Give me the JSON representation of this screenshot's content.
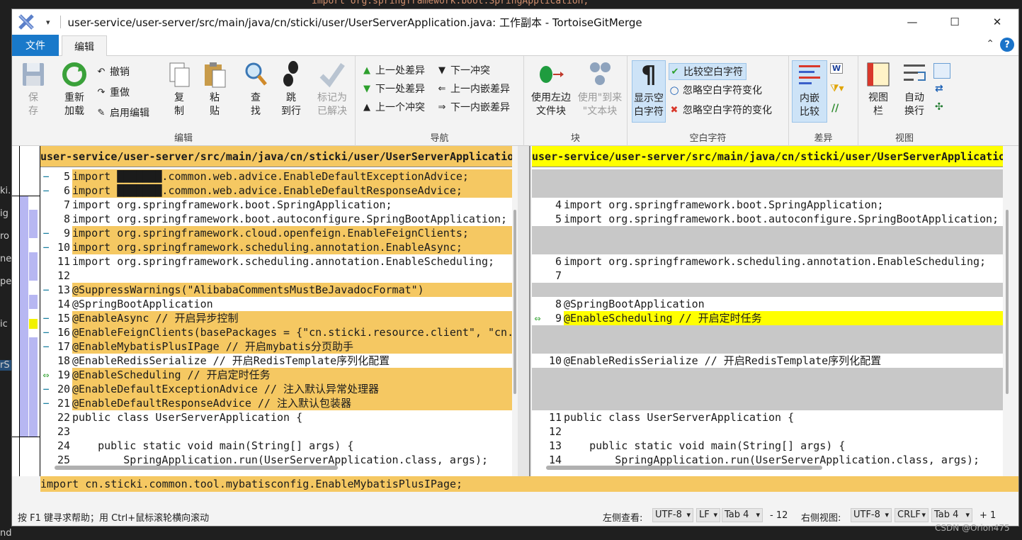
{
  "window": {
    "title": "user-service/user-server/src/main/java/cn/sticki/user/UserServerApplication.java: 工作副本 - TortoiseGitMerge",
    "minimize": "—",
    "maximize": "☐",
    "close": "✕"
  },
  "background": {
    "top_code": "import org.springframework.boot.SpringApplication;",
    "left_snippets": [
      "ki.u",
      "ig",
      "ro",
      "ne",
      "pe",
      "ic",
      "rS",
      "nd"
    ],
    "watermark": "CSDN @Orion475"
  },
  "tabs": {
    "file": "文件",
    "edit": "编辑"
  },
  "ribbon": {
    "edit_group": {
      "name": "编辑",
      "save": "保\n存",
      "reload": "重新\n加载",
      "undo": "撤销",
      "redo": "重做",
      "enable_edit": "启用编辑",
      "copy": "复\n制",
      "paste": "粘\n贴"
    },
    "nav_group": {
      "name": "导航",
      "find": "查\n找",
      "goto": "跳\n到行",
      "mark_resolved": "标记为\n已解决",
      "prev_diff": "上一处差异",
      "next_diff": "下一处差异",
      "prev_conflict": "上一个冲突",
      "next_conflict": "下一冲突",
      "prev_inline": "上一内嵌差异",
      "next_inline": "下一内嵌差异"
    },
    "block_group": {
      "name": "块",
      "use_left": "使用左边\n文件块",
      "use_from": "使用\"到来\n\"文本块"
    },
    "whitespace_group": {
      "name": "空白字符",
      "show_ws": "显示空\n白字符",
      "compare_ws": "比较空白字符",
      "ignore_ws_change": "忽略空白字符变化",
      "ignore_ws_all": "忽略空白字符的变化"
    },
    "diff_group": {
      "name": "差异",
      "inline": "内嵌\n比较"
    },
    "view_group": {
      "name": "视图",
      "viewbar": "视图\n栏",
      "wrap": "自动\n换行"
    }
  },
  "left_pane": {
    "path": "user-service/user-server/src/main/java/cn/sticki/user/UserServerApplication.java",
    "lines": [
      {
        "n": "5",
        "m": "−",
        "t": "import ███████.common.web.advice.EnableDefaultExceptionAdvice;",
        "bg": "#f5c862"
      },
      {
        "n": "6",
        "m": "−",
        "t": "import ███████.common.web.advice.EnableDefaultResponseAdvice;",
        "bg": "#f5c862"
      },
      {
        "n": "7",
        "m": "",
        "t": "import org.springframework.boot.SpringApplication;",
        "bg": "#ffffff"
      },
      {
        "n": "8",
        "m": "",
        "t": "import org.springframework.boot.autoconfigure.SpringBootApplication;",
        "bg": "#ffffff"
      },
      {
        "n": "9",
        "m": "−",
        "t": "import org.springframework.cloud.openfeign.EnableFeignClients;",
        "bg": "#f5c862"
      },
      {
        "n": "10",
        "m": "−",
        "t": "import org.springframework.scheduling.annotation.EnableAsync;",
        "bg": "#f5c862"
      },
      {
        "n": "11",
        "m": "",
        "t": "import org.springframework.scheduling.annotation.EnableScheduling;",
        "bg": "#ffffff"
      },
      {
        "n": "12",
        "m": "",
        "t": "",
        "bg": "#ffffff"
      },
      {
        "n": "13",
        "m": "−",
        "t": "@SuppressWarnings(\"AlibabaCommentsMustBeJavadocFormat\")",
        "bg": "#f5c862"
      },
      {
        "n": "14",
        "m": "",
        "t": "@SpringBootApplication",
        "bg": "#ffffff"
      },
      {
        "n": "15",
        "m": "−",
        "t": "@EnableAsync // 开启异步控制",
        "bg": "#f5c862"
      },
      {
        "n": "16",
        "m": "−",
        "t": "@EnableFeignClients(basePackages = {\"cn.sticki.resource.client\", \"cn.",
        "bg": "#f5c862"
      },
      {
        "n": "17",
        "m": "−",
        "t": "@EnableMybatisPlusIPage // 开启mybatis分页助手",
        "bg": "#f5c862"
      },
      {
        "n": "18",
        "m": "",
        "t": "@EnableRedisSerialize // 开启RedisTemplate序列化配置",
        "bg": "#ffffff"
      },
      {
        "n": "19",
        "m": "⇔",
        "t": "@EnableScheduling // 开启定时任务",
        "bg": "#f5c862"
      },
      {
        "n": "20",
        "m": "−",
        "t": "@EnableDefaultExceptionAdvice // 注入默认异常处理器",
        "bg": "#f5c862"
      },
      {
        "n": "21",
        "m": "−",
        "t": "@EnableDefaultResponseAdvice // 注入默认包装器",
        "bg": "#f5c862"
      },
      {
        "n": "22",
        "m": "",
        "t": "public class UserServerApplication {",
        "bg": "#ffffff"
      },
      {
        "n": "23",
        "m": "",
        "t": "",
        "bg": "#ffffff"
      },
      {
        "n": "24",
        "m": "",
        "t": "    public static void main(String[] args) {",
        "bg": "#ffffff"
      },
      {
        "n": "25",
        "m": "",
        "t": "        SpringApplication.run(UserServerApplication.class, args);",
        "bg": "#ffffff"
      }
    ]
  },
  "right_pane": {
    "path": "user-service/user-server/src/main/java/cn/sticki/user/UserServerApplication.java",
    "lines": [
      {
        "n": "",
        "m": "",
        "t": "",
        "bg": "#c8c8c8"
      },
      {
        "n": "",
        "m": "",
        "t": "",
        "bg": "#c8c8c8"
      },
      {
        "n": "4",
        "m": "",
        "t": "import org.springframework.boot.SpringApplication;",
        "bg": "#ffffff"
      },
      {
        "n": "5",
        "m": "",
        "t": "import org.springframework.boot.autoconfigure.SpringBootApplication;",
        "bg": "#ffffff"
      },
      {
        "n": "",
        "m": "",
        "t": "",
        "bg": "#c8c8c8"
      },
      {
        "n": "",
        "m": "",
        "t": "",
        "bg": "#c8c8c8"
      },
      {
        "n": "6",
        "m": "",
        "t": "import org.springframework.scheduling.annotation.EnableScheduling;",
        "bg": "#ffffff"
      },
      {
        "n": "7",
        "m": "",
        "t": "",
        "bg": "#ffffff"
      },
      {
        "n": "",
        "m": "",
        "t": "",
        "bg": "#c8c8c8"
      },
      {
        "n": "8",
        "m": "",
        "t": "@SpringBootApplication",
        "bg": "#ffffff"
      },
      {
        "n": "9",
        "m": "⇔",
        "t": "@EnableScheduling // 开启定时任务",
        "bg": "#ffff00"
      },
      {
        "n": "",
        "m": "",
        "t": "",
        "bg": "#c8c8c8"
      },
      {
        "n": "",
        "m": "",
        "t": "",
        "bg": "#c8c8c8"
      },
      {
        "n": "10",
        "m": "",
        "t": "@EnableRedisSerialize // 开启RedisTemplate序列化配置",
        "bg": "#ffffff"
      },
      {
        "n": "",
        "m": "",
        "t": "",
        "bg": "#c8c8c8"
      },
      {
        "n": "",
        "m": "",
        "t": "",
        "bg": "#c8c8c8"
      },
      {
        "n": "",
        "m": "",
        "t": "",
        "bg": "#c8c8c8"
      },
      {
        "n": "11",
        "m": "",
        "t": "public class UserServerApplication {",
        "bg": "#ffffff"
      },
      {
        "n": "12",
        "m": "",
        "t": "",
        "bg": "#ffffff"
      },
      {
        "n": "13",
        "m": "",
        "t": "    public static void main(String[] args) {",
        "bg": "#ffffff"
      },
      {
        "n": "14",
        "m": "",
        "t": "        SpringApplication.run(UserServerApplication.class, args);",
        "bg": "#ffffff"
      }
    ]
  },
  "bottom_pane": {
    "line": "import cn.sticki.common.tool.mybatisconfig.EnableMybatisPlusIPage;"
  },
  "status": {
    "help": "按 F1 键寻求帮助；用 Ctrl+鼠标滚轮横向滚动",
    "left_view": "左侧查看:",
    "left_enc": "UTF-8",
    "left_eol": "LF",
    "left_tab": "Tab 4",
    "left_count": "- 12",
    "right_view": "右侧视图:",
    "right_enc": "UTF-8",
    "right_eol": "CRLF",
    "right_tab": "Tab 4",
    "right_count": "+ 1"
  },
  "colors": {
    "accent": "#1979ca",
    "removed": "#f5c862",
    "moved": "#ffff00",
    "empty": "#c8c8c8",
    "redacted": "#e8231f"
  }
}
